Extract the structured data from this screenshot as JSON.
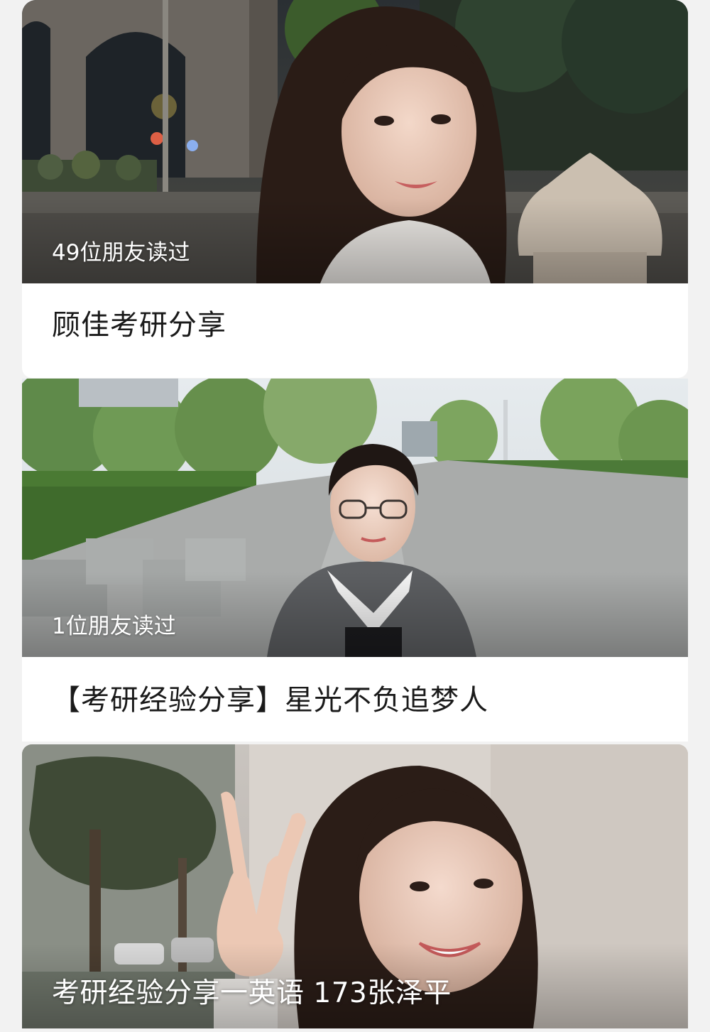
{
  "articles": [
    {
      "read_count": "49位朋友读过",
      "title": "顾佳考研分享",
      "cover_image": "night campus archway portrait"
    },
    {
      "read_count": "1位朋友读过",
      "title": "【考研经验分享】星光不负追梦人",
      "cover_image": "campus plaza portrait with glasses"
    },
    {
      "title": "考研经验分享一英语 173张泽平",
      "cover_image": "peace sign selfie portrait"
    }
  ]
}
